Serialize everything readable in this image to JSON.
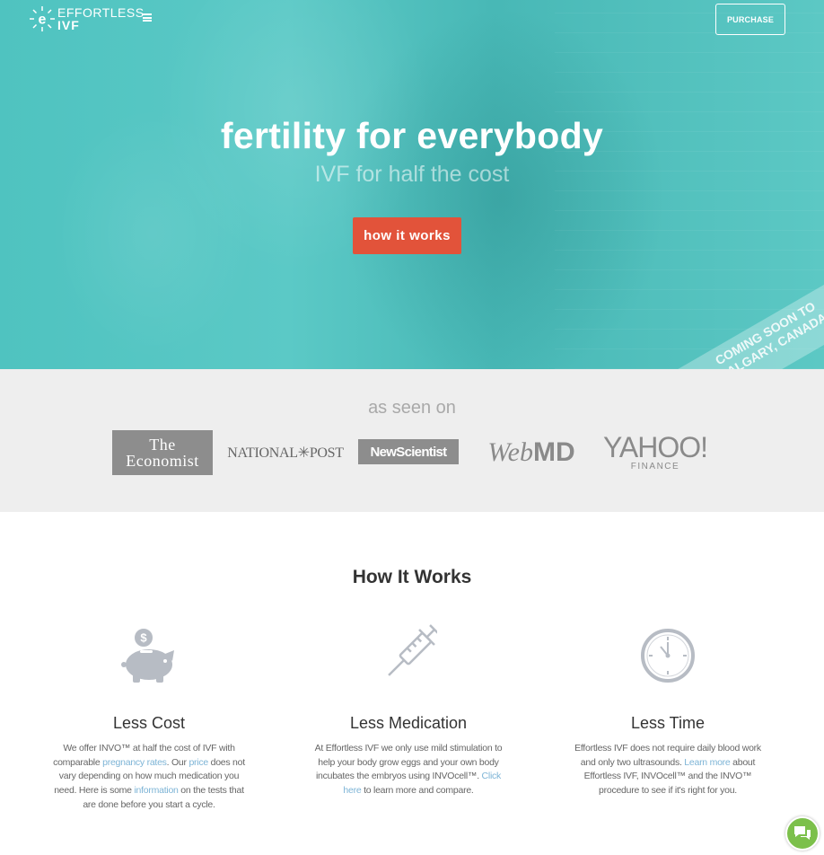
{
  "header": {
    "logo_line1": "EFFORTLESS",
    "logo_line2": "IVF",
    "purchase_label": "PURCHASE"
  },
  "hero": {
    "headline": "fertility for everybody",
    "subheadline": "IVF for half the cost",
    "cta_label": "how it works",
    "ribbon_line1": "COMING SOON TO",
    "ribbon_line2": "CALGARY, CANADA"
  },
  "press": {
    "title": "as seen on",
    "logos": {
      "economist_1": "The",
      "economist_2": "Economist",
      "national_post": "NATIONAL✳POST",
      "new_scientist": "NewScientist",
      "webmd_1": "Web",
      "webmd_2": "MD",
      "yahoo_1": "YAHOO!",
      "yahoo_2": "FINANCE"
    }
  },
  "how_it_works": {
    "title": "How It Works",
    "columns": [
      {
        "icon": "piggy-bank-icon",
        "heading": "Less Cost",
        "text_a": "We offer INVO™ at half the cost of IVF with comparable ",
        "link_a": "pregnancy rates",
        "text_b": ". Our ",
        "link_b": "price",
        "text_c": " does not vary depending on how much medication you need. Here is some ",
        "link_c": "information",
        "text_d": " on the tests that are done before you start a cycle."
      },
      {
        "icon": "syringe-icon",
        "heading": "Less Medication",
        "text_a": "At Effortless IVF we only use mild stimulation to help your body grow eggs and your own body incubates the embryos using INVOcell™. ",
        "link_a": "Click here",
        "text_b": " to learn more and compare."
      },
      {
        "icon": "clock-icon",
        "heading": "Less Time",
        "text_a": "Effortless IVF does not require daily blood work and only two ultrasounds. ",
        "link_a": "Learn more",
        "text_b": " about Effortless IVF, INVOcell™ and the INVO™ procedure to see if it's right for you."
      }
    ]
  },
  "colors": {
    "hero_teal": "#55c3c0",
    "cta_red": "#e2533a",
    "link_blue": "#7db4d6",
    "chat_green": "#7cc04b"
  }
}
